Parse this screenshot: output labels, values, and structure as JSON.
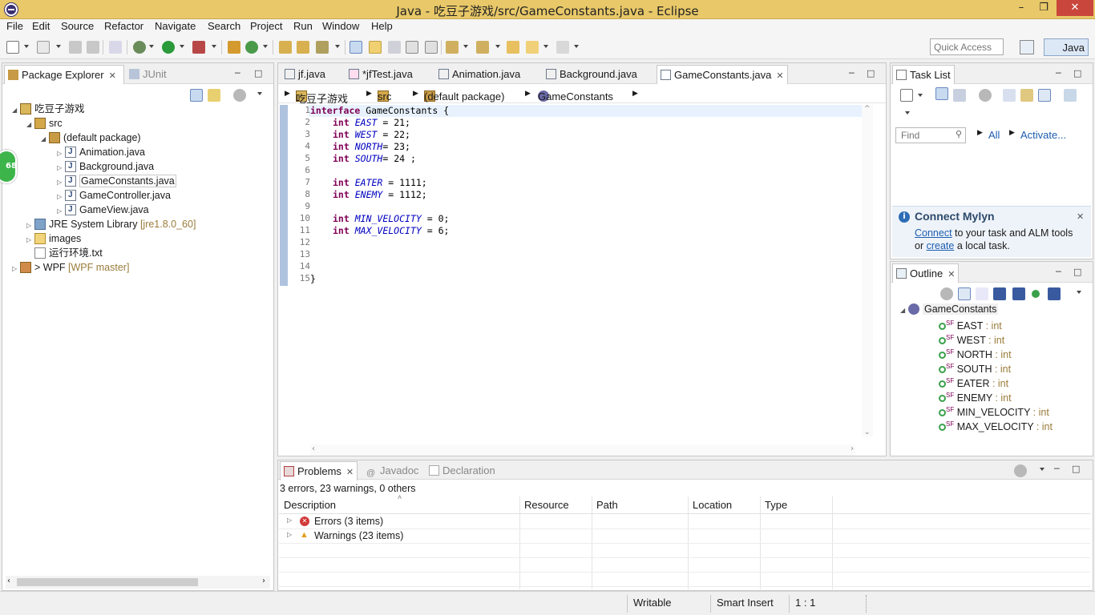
{
  "window": {
    "title": "Java - 吃豆子游戏/src/GameConstants.java - Eclipse",
    "minimize": "–",
    "maximize": "❐",
    "close": "✕"
  },
  "menu": [
    "File",
    "Edit",
    "Source",
    "Refactor",
    "Navigate",
    "Search",
    "Project",
    "Run",
    "Window",
    "Help"
  ],
  "toolbar": {
    "quick_access_placeholder": "Quick Access",
    "perspective_label": "Java"
  },
  "package_explorer": {
    "tabs": [
      {
        "label": "Package Explorer",
        "close": "✕"
      },
      {
        "label": "JUnit"
      }
    ],
    "badge": "68",
    "tree": [
      {
        "label": "吃豆子游戏",
        "icon": "project-icon",
        "arrow": "◢"
      },
      {
        "label": "src",
        "icon": "source-folder-icon",
        "arrow": "◢"
      },
      {
        "label": "(default package)",
        "icon": "package-icon",
        "arrow": "◢"
      },
      {
        "label": "Animation.java",
        "icon": "java-file-icon",
        "arrow": "▷"
      },
      {
        "label": "Background.java",
        "icon": "java-file-icon",
        "arrow": "▷"
      },
      {
        "label": "GameConstants.java",
        "icon": "java-file-icon",
        "arrow": "▷"
      },
      {
        "label": "GameController.java",
        "icon": "java-file-icon",
        "arrow": "▷"
      },
      {
        "label": "GameView.java",
        "icon": "java-file-icon",
        "arrow": "▷"
      },
      {
        "label": "JRE System Library",
        "decoration": "[jre1.8.0_60]",
        "icon": "library-icon",
        "arrow": "▷"
      },
      {
        "label": "images",
        "icon": "folder-icon",
        "arrow": "▷"
      },
      {
        "label": "运行环境.txt",
        "icon": "text-file-icon",
        "arrow": ""
      },
      {
        "label": "> WPF",
        "decoration": "[WPF master]",
        "icon": "git-project-icon",
        "arrow": "▷"
      }
    ]
  },
  "editor": {
    "tabs": [
      {
        "label": "jf.java"
      },
      {
        "label": "*jfTest.java"
      },
      {
        "label": "Animation.java"
      },
      {
        "label": "Background.java"
      },
      {
        "label": "GameConstants.java",
        "close": "✕"
      }
    ],
    "breadcrumb": [
      "吃豆子游戏",
      "src",
      "(default package)",
      "GameConstants"
    ],
    "line_numbers": [
      "1",
      "2",
      "3",
      "4",
      "5",
      "6",
      "7",
      "8",
      "9",
      "10",
      "11",
      "12",
      "13",
      "14",
      "15"
    ],
    "code": {
      "l1_kw": "interface",
      "l1_rest": " GameConstants {",
      "l2_kw": "int",
      "l2_fld": "EAST",
      "l2_rest": " = 21;",
      "l3_kw": "int",
      "l3_fld": "WEST",
      "l3_rest": " = 22;",
      "l4_kw": "int",
      "l4_fld": "NORTH",
      "l4_rest": "= 23;",
      "l5_kw": "int",
      "l5_fld": "SOUTH",
      "l5_rest": "= 24 ;",
      "l7_kw": "int",
      "l7_fld": "EATER",
      "l7_rest": " = 1111;",
      "l8_kw": "int",
      "l8_fld": "ENEMY",
      "l8_rest": " = 1112;",
      "l10_kw": "int",
      "l10_fld": "MIN_VELOCITY",
      "l10_rest": " = 0;",
      "l11_kw": "int",
      "l11_fld": "MAX_VELOCITY",
      "l11_rest": " = 6;",
      "l15": "}"
    }
  },
  "task_list": {
    "tab_label": "Task List",
    "find_placeholder": "Find",
    "all_label": "All",
    "activate_label": "Activate..."
  },
  "mylyn": {
    "title": "Connect Mylyn",
    "connect_link": "Connect",
    "text1": " to your task and ALM tools",
    "text2a": "or ",
    "create_link": "create",
    "text2b": " a local task."
  },
  "outline": {
    "tab_label": "Outline",
    "root": "GameConstants",
    "fields": [
      {
        "name": "EAST",
        "type": " : int"
      },
      {
        "name": "WEST",
        "type": " : int"
      },
      {
        "name": "NORTH",
        "type": " : int"
      },
      {
        "name": "SOUTH",
        "type": " : int"
      },
      {
        "name": "EATER",
        "type": " : int"
      },
      {
        "name": "ENEMY",
        "type": " : int"
      },
      {
        "name": "MIN_VELOCITY",
        "type": " : int"
      },
      {
        "name": "MAX_VELOCITY",
        "type": " : int"
      }
    ],
    "field_badge": "SF"
  },
  "problems": {
    "tabs": [
      {
        "label": "Problems",
        "close": "✕"
      },
      {
        "label": "Javadoc"
      },
      {
        "label": "Declaration"
      }
    ],
    "summary": "3 errors, 23 warnings, 0 others",
    "columns": [
      "Description",
      "Resource",
      "Path",
      "Location",
      "Type"
    ],
    "rows": [
      {
        "label": "Errors (3 items)",
        "kind": "error"
      },
      {
        "label": "Warnings (23 items)",
        "kind": "warning"
      }
    ]
  },
  "status": {
    "writable": "Writable",
    "insert_mode": "Smart Insert",
    "position": "1 : 1"
  }
}
